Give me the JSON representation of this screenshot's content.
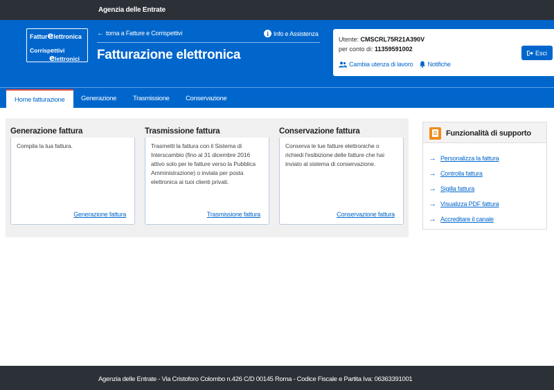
{
  "topbar": {
    "agency": "Agenzia delle Entrate"
  },
  "logo": {
    "line1": "Fatture elettroniche",
    "line1_a": "Fattur",
    "line1_b": "lettronica",
    "line2_a": "Corrisp",
    "line2_b": "ttivi",
    "line2_c": "lettronici"
  },
  "header": {
    "back_link": "torna a Fatture e Corrispettivi",
    "info_link": "Info e Assistenza",
    "title": "Fatturazione elettronica"
  },
  "user": {
    "label": "Utente:",
    "code": "CMSCRL75R21A390V",
    "on_behalf_label": "per conto di:",
    "on_behalf_value": "11359591002",
    "change_utenza": "Cambia utenza di lavoro",
    "notifiche": "Notifiche",
    "esci": "Esci"
  },
  "nav": {
    "tabs": [
      {
        "label": "Home fatturazione",
        "active": true
      },
      {
        "label": "Generazione"
      },
      {
        "label": "Trasmissione"
      },
      {
        "label": "Conservazione"
      }
    ]
  },
  "cards": [
    {
      "title": "Generazione fattura",
      "desc": "Compila la tua fattura.",
      "link": "Generazione fattura"
    },
    {
      "title": "Trasmissione fattura",
      "desc": "Trasmetti la fattura con il Sistema di Interscambio (fino al 31 dicembre 2016 attivo solo per le fatture verso la Pubblica Amministrazione) o inviala per posta elettronica ai tuoi clienti privati.",
      "link": "Trasmissione fattura"
    },
    {
      "title": "Conservazione fattura",
      "desc": "Conserva le tue fatture elettroniche o richiedi l'esibizione delle fatture che hai inviato al sistema di conservazione.",
      "link": "Conservazione fattura"
    }
  ],
  "support": {
    "title": "Funzionalità  di supporto",
    "items": [
      {
        "label": "Personalizza la fattura"
      },
      {
        "label": "Controlla fattura"
      },
      {
        "label": "Sigilla fattura"
      },
      {
        "label": "Visualizza PDF fattura"
      },
      {
        "label": "Accreditare il canale"
      }
    ]
  },
  "footer": {
    "text": "Agenzia delle Entrate - Via Cristoforo Colombo n.426 C/D 00145 Roma - Codice Fiscale e Partita Iva: 06363391001"
  },
  "colors": {
    "brand_blue": "#0066cc",
    "dark_bar": "#2c3138",
    "accent_orange": "#f08c1a",
    "active_tab_border": "#d84a3f"
  },
  "icons": {
    "back": "arrow-left-icon",
    "info": "info-circle-icon",
    "users": "users-icon",
    "bell": "bell-icon",
    "logout": "sign-out-icon",
    "support_header": "document-icon",
    "support_item": "arrow-right-icon"
  }
}
